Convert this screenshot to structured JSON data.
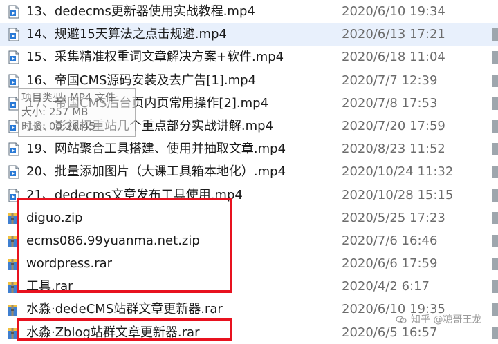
{
  "files": [
    {
      "name": "13、dedecms更新器使用实战教程.mp4",
      "date": "2020/6/10 19:34",
      "icon": "video-file-icon"
    },
    {
      "name": "14、规避15天算法之点击规避.mp4",
      "date": "2020/6/13 17:21",
      "icon": "video-file-icon",
      "selected": true
    },
    {
      "name": "15、采集精准权重词文章解决方案+软件.mp4",
      "date": "2020/6/18 11:04",
      "icon": "video-file-icon"
    },
    {
      "name": "16、帝国CMS源码安装及去广告[1].mp4",
      "date": "2020/7/7 12:39",
      "icon": "video-file-icon"
    },
    {
      "name": "17、帝国CMS后台页内页常用操作[2].mp4",
      "date": "2020/7/8 17:53",
      "icon": "video-file-icon"
    },
    {
      "name": "18、影视权重站几个重点部分实战讲解.mp4",
      "date": "2020/7/20 17:59",
      "icon": "video-file-icon"
    },
    {
      "name": "19、网站聚合工具搭建、使用并抽取文章.mp4",
      "date": "2020/8/23 11:52",
      "icon": "video-file-icon"
    },
    {
      "name": "20、批量添加图片（大课工具箱本地化）.mp4",
      "date": "2020/10/24 11:32",
      "icon": "video-file-icon"
    },
    {
      "name": "21、dedecms文章发布工具使用.mp4",
      "date": "2020/10/28 15:15",
      "icon": "video-file-icon"
    },
    {
      "name": "diguo.zip",
      "date": "2020/5/25 17:23",
      "icon": "archive-icon"
    },
    {
      "name": "ecms086.99yuanma.net.zip",
      "date": "2020/7/6 16:46",
      "icon": "archive-icon"
    },
    {
      "name": "wordpress.rar",
      "date": "2020/6/6 17:59",
      "icon": "archive-icon"
    },
    {
      "name": "工具.rar",
      "date": "2020/4/2 6:17",
      "icon": "archive-icon"
    },
    {
      "name": "水淼·dedeCMS站群文章更新器.rar",
      "date": "2020/6/10 19:35",
      "icon": "archive-icon"
    },
    {
      "name": "水淼·Zblog站群文章更新器.rar",
      "date": "2020/6/5 16:57",
      "icon": "archive-icon"
    }
  ],
  "tooltip": {
    "type": "项目类型: MP4 文件",
    "size": "大小: 257 MB",
    "duration": "时长: 00:26:45"
  },
  "watermark": "知乎 @糖哥王龙",
  "colors": {
    "highlight": "#e8121f",
    "selected_row": "#e8f0fc"
  }
}
